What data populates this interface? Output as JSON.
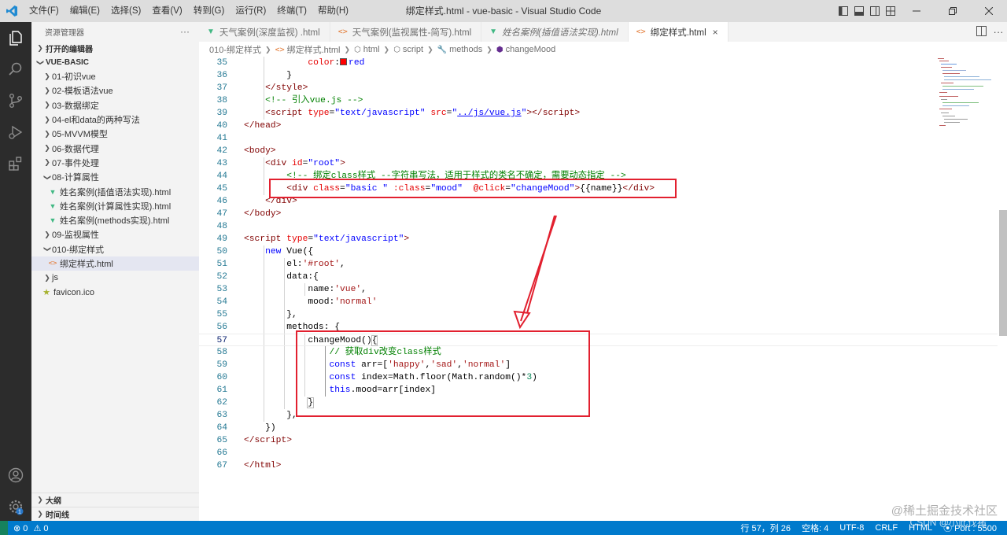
{
  "window": {
    "title": "绑定样式.html - vue-basic - Visual Studio Code",
    "menu": [
      "文件(F)",
      "编辑(E)",
      "选择(S)",
      "查看(V)",
      "转到(G)",
      "运行(R)",
      "终端(T)",
      "帮助(H)"
    ]
  },
  "sidebar": {
    "title": "资源管理器",
    "more": "···",
    "open_editors": "打开的编辑器",
    "project": "VUE-BASIC",
    "items": [
      {
        "label": "01-初识vue",
        "type": "folder"
      },
      {
        "label": "02-模板语法vue",
        "type": "folder"
      },
      {
        "label": "03-数据绑定",
        "type": "folder"
      },
      {
        "label": "04-el和data的两种写法",
        "type": "folder"
      },
      {
        "label": "05-MVVM模型",
        "type": "folder"
      },
      {
        "label": "06-数据代理",
        "type": "folder"
      },
      {
        "label": "07-事件处理",
        "type": "folder"
      },
      {
        "label": "08-计算属性",
        "type": "folder-open"
      },
      {
        "label": "姓名案例(插值语法实现).html",
        "type": "vue"
      },
      {
        "label": "姓名案例(计算属性实现).html",
        "type": "vue"
      },
      {
        "label": "姓名案例(methods实现).html",
        "type": "vue"
      },
      {
        "label": "09-监视属性",
        "type": "folder"
      },
      {
        "label": "010-绑定样式",
        "type": "folder-open"
      },
      {
        "label": "绑定样式.html",
        "type": "html"
      },
      {
        "label": "js",
        "type": "folder"
      },
      {
        "label": "favicon.ico",
        "type": "star"
      }
    ],
    "outline": "大纲",
    "timeline": "时间线"
  },
  "tabs": [
    {
      "label": "天气案例(深度监视) .html",
      "icon": "vue"
    },
    {
      "label": "天气案例(监视属性-简写).html",
      "icon": "html"
    },
    {
      "label": "姓名案例(插值语法实现).html",
      "icon": "vue"
    },
    {
      "label": "绑定样式.html",
      "icon": "html",
      "close": "×"
    }
  ],
  "breadcrumb": [
    "010-绑定样式",
    "绑定样式.html",
    "html",
    "script",
    "methods",
    "changeMood"
  ],
  "editor": {
    "line_numbers": [
      "35",
      "36",
      "37",
      "38",
      "39",
      "40",
      "41",
      "42",
      "43",
      "44",
      "45",
      "46",
      "47",
      "48",
      "49",
      "50",
      "51",
      "52",
      "53",
      "54",
      "55",
      "56",
      "57",
      "58",
      "59",
      "60",
      "61",
      "62",
      "63",
      "64",
      "65",
      "66",
      "67"
    ],
    "current_line": "57"
  },
  "statusbar": {
    "errors": "0",
    "warnings": "0",
    "position": "行 57，列 26",
    "spaces": "空格: 4",
    "encoding": "UTF-8",
    "eol": "CRLF",
    "language": "HTML",
    "port": "Port : 5500"
  },
  "watermark": "@稀土掘金技术社区",
  "watermark2": "CSDN @小此伐猪"
}
